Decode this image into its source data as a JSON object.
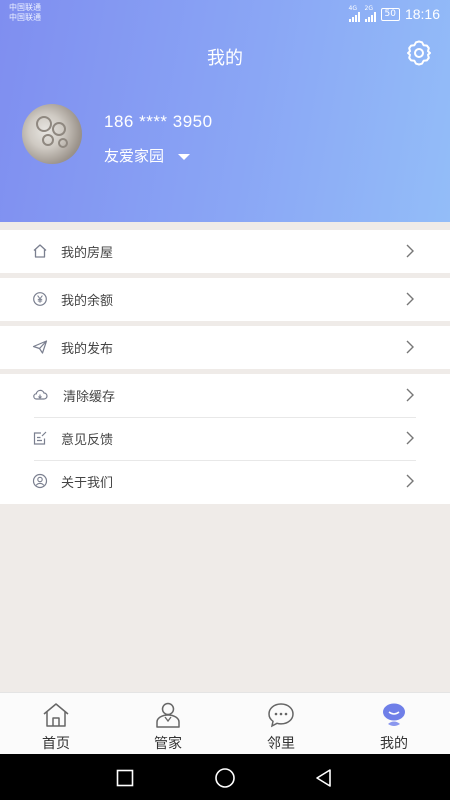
{
  "status": {
    "carrier_line1": "中国联通",
    "carrier_line2": "中国联通",
    "sig1_label": "4G",
    "sig2_label": "2G",
    "battery": "50",
    "time": "18:16"
  },
  "header": {
    "title": "我的",
    "phone": "186 **** 3950",
    "community": "友爱家园"
  },
  "menu": {
    "house": "我的房屋",
    "balance": "我的余额",
    "publish": "我的发布",
    "cache": "清除缓存",
    "feedback": "意见反馈",
    "about": "关于我们"
  },
  "tabs": [
    {
      "label": "首页",
      "icon": "home-icon"
    },
    {
      "label": "管家",
      "icon": "butler-icon"
    },
    {
      "label": "邻里",
      "icon": "chat-icon"
    },
    {
      "label": "我的",
      "icon": "profile-icon"
    }
  ],
  "colors": {
    "header_start": "#7f8ef0",
    "header_end": "#93bdf8",
    "active_tab": "#6f7fe8",
    "icon_gray": "#7a7f8f"
  }
}
